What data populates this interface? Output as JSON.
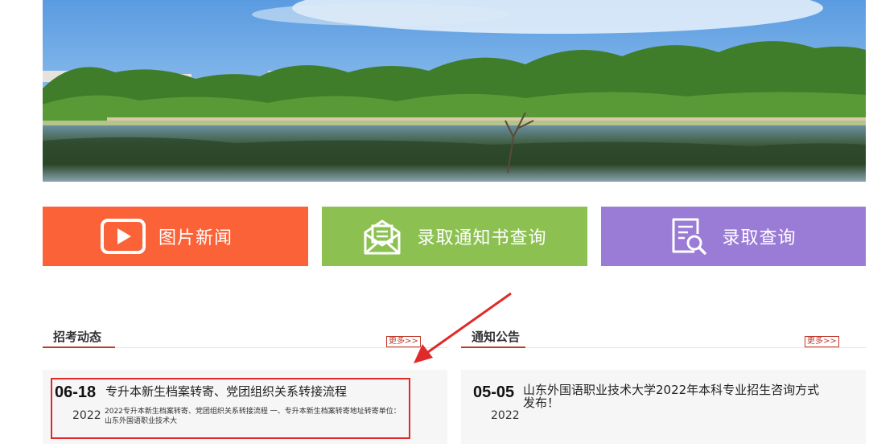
{
  "colors": {
    "tile_news": "#fb6238",
    "tile_notice": "#8cc152",
    "tile_admission": "#9a7bd6",
    "accent_red": "#c0392b",
    "annotation_red": "#e02a2a"
  },
  "tiles": [
    {
      "label": "图片新闻",
      "icon": "play-icon"
    },
    {
      "label": "录取通知书查询",
      "icon": "envelope-icon"
    },
    {
      "label": "录取查询",
      "icon": "document-search-icon"
    }
  ],
  "sections": {
    "left": {
      "title": "招考动态",
      "more": "更多>>",
      "items": [
        {
          "day": "06-18",
          "year": "2022",
          "title": "专升本新生档案转寄、党团组织关系转接流程",
          "summary": "2022专升本新生档案转寄、党团组织关系转接流程 一、专升本新生档案转寄地址转寄单位：山东外国语职业技术大"
        }
      ]
    },
    "right": {
      "title": "通知公告",
      "more": "更多>>",
      "items": [
        {
          "day": "05-05",
          "year": "2022",
          "title": "山东外国语职业技术大学2022年本科专业招生咨询方式发布！"
        }
      ]
    }
  }
}
